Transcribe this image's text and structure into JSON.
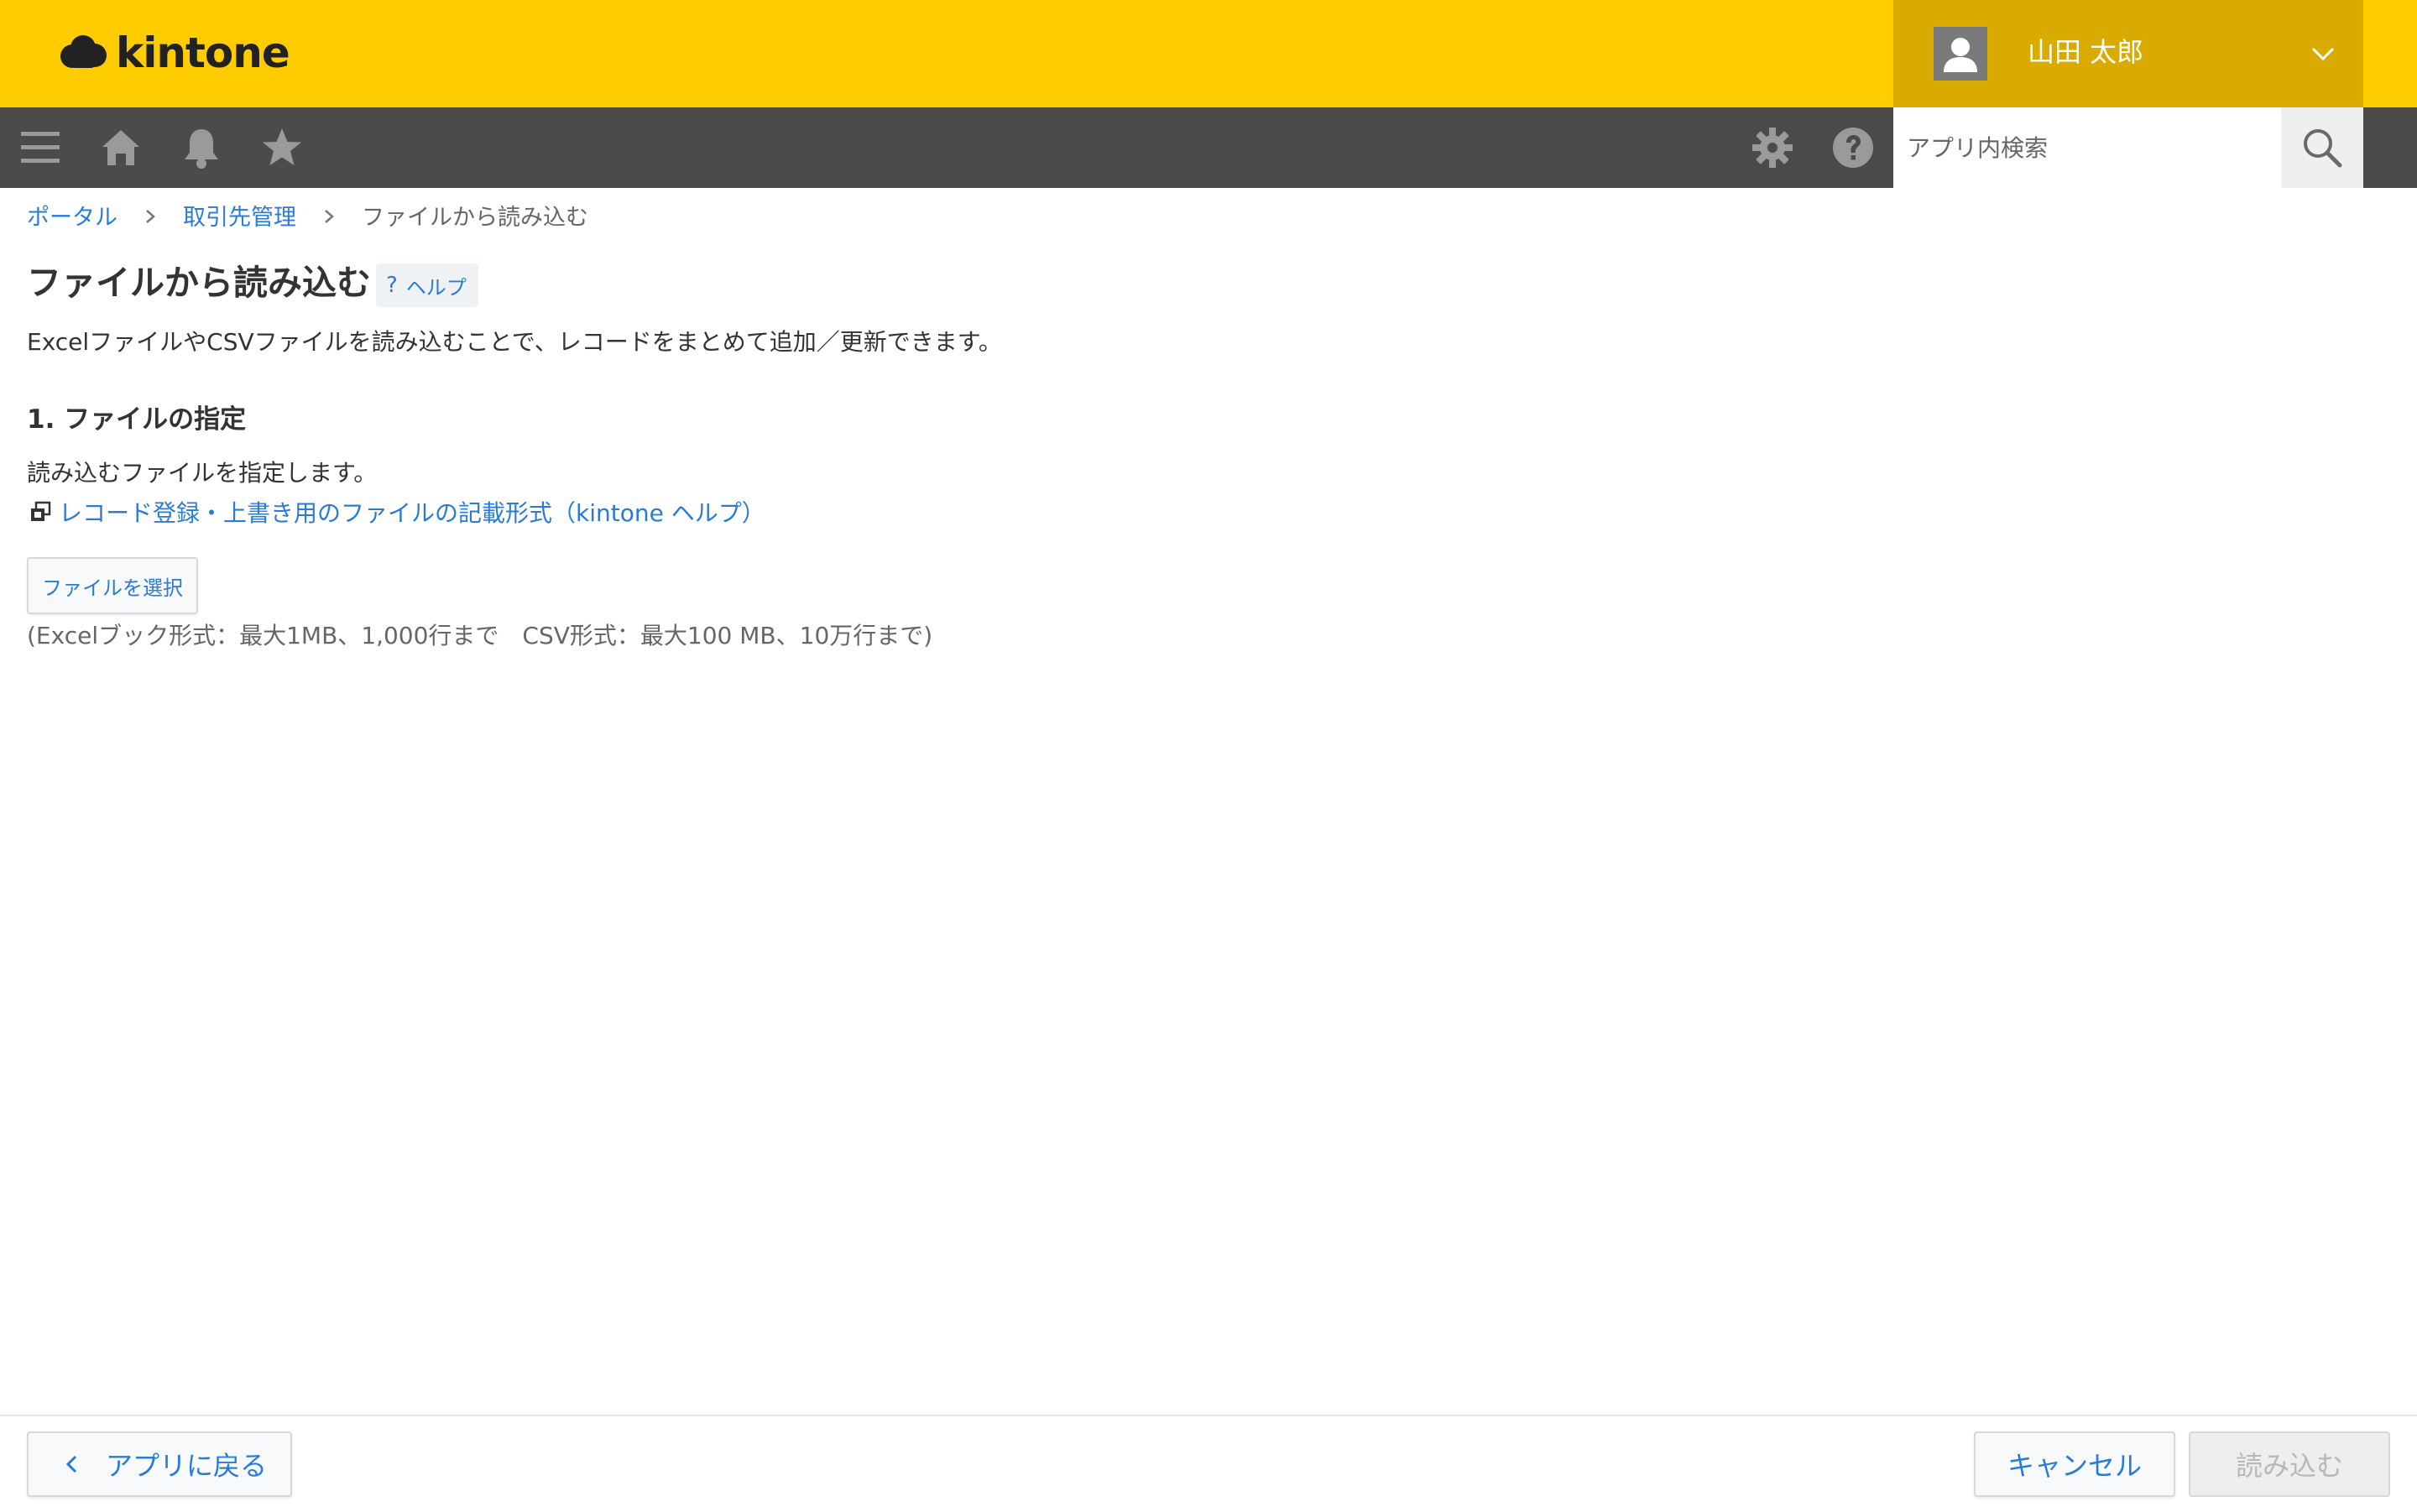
{
  "brand": {
    "logo_text": "kintone",
    "logo_icon": "kintone-cloud-logo"
  },
  "header": {
    "user_name": "山田 太郎",
    "avatar_icon": "user-avatar-icon",
    "menu_icon": "chevron-down-icon"
  },
  "navbar": {
    "left_icons": [
      "menu-icon",
      "home-icon",
      "bell-icon",
      "star-icon"
    ],
    "right_icons": [
      "gear-icon",
      "help-circle-icon"
    ],
    "search": {
      "placeholder": "アプリ内検索",
      "value": "",
      "button_icon": "search-icon"
    }
  },
  "breadcrumb": {
    "items": [
      {
        "label": "ポータル"
      },
      {
        "label": "取引先管理"
      },
      {
        "label": "ファイルから読み込む"
      }
    ]
  },
  "main": {
    "title": "ファイルから読み込む",
    "help": {
      "icon": "?",
      "label": "ヘルプ"
    },
    "description": "ExcelファイルやCSVファイルを読み込むことで、レコードをまとめて追加／更新できます。",
    "section": {
      "title": "1. ファイルの指定",
      "text": "読み込むファイルを指定します。",
      "link_label": "レコード登録・上書き用のファイルの記載形式（kintone ヘルプ）",
      "link_icon": "external-window-icon",
      "file_button": "ファイルを選択",
      "limits": "(Excelブック形式：最大1MB、1,000行まで　CSV形式：最大100 MB、10万行まで)"
    }
  },
  "footer": {
    "back_label": "アプリに戻る",
    "cancel_label": "キャンセル",
    "import_label": "読み込む"
  },
  "colors": {
    "header_yellow": "#ffcc00",
    "user_menu_bg": "#d9ab00",
    "navbar_bg": "#4b4b4b",
    "link_blue": "#2a7bd6",
    "text": "#333333"
  }
}
